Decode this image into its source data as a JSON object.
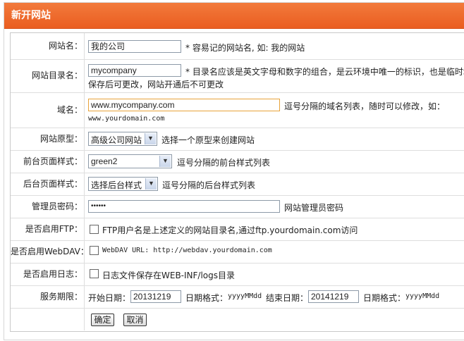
{
  "title": "新开网站",
  "fields": {
    "site_name": {
      "label": "网站名：",
      "value": "我的公司",
      "hint": "* 容易记的网站名, 如: 我的网站"
    },
    "site_dir": {
      "label": "网站目录名：",
      "value": "mycompany",
      "hint_line1": "* 目录名应该是英文字母和数字的组合，是云环境中唯一的标识，也是临时域",
      "hint_line2": "保存后可更改，网站开通后不可更改"
    },
    "domain": {
      "label": "域名：",
      "value": "www.mycompany.com",
      "hint": "逗号分隔的域名列表，随时可以修改，如：",
      "example": "www.yourdomain.com"
    },
    "prototype": {
      "label": "网站原型：",
      "selected": "高级公司网站",
      "hint": "选择一个原型来创建网站"
    },
    "front_style": {
      "label": "前台页面样式：",
      "selected": "green2",
      "hint": "逗号分隔的前台样式列表"
    },
    "back_style": {
      "label": "后台页面样式：",
      "selected": "选择后台样式",
      "hint": "逗号分隔的后台样式列表"
    },
    "admin_pwd": {
      "label": "管理员密码：",
      "value": "••••••",
      "hint": "网站管理员密码"
    },
    "ftp": {
      "label": "是否启用FTP：",
      "hint": "FTP用户名是上述定义的网站目录名,通过ftp.yourdomain.com访问",
      "checked": false
    },
    "webdav": {
      "label": "是否启用WebDAV：",
      "hint": "WebDAV URL: http://webdav.yourdomain.com",
      "checked": false
    },
    "log": {
      "label": "是否启用日志：",
      "hint": "日志文件保存在WEB-INF/logs目录",
      "checked": false
    },
    "service": {
      "label": "服务期限：",
      "start_label": "开始日期：",
      "start_value": "20131219",
      "format_label": "日期格式：",
      "format": "yyyyMMdd",
      "end_label": "结束日期：",
      "end_value": "20141219",
      "format_label2": "日期格式：",
      "format2": "yyyyMMdd"
    }
  },
  "buttons": {
    "ok": "确定",
    "cancel": "取消"
  },
  "colors": {
    "title_bar": "#ea5d20",
    "focus_border": "#e8a33a"
  }
}
